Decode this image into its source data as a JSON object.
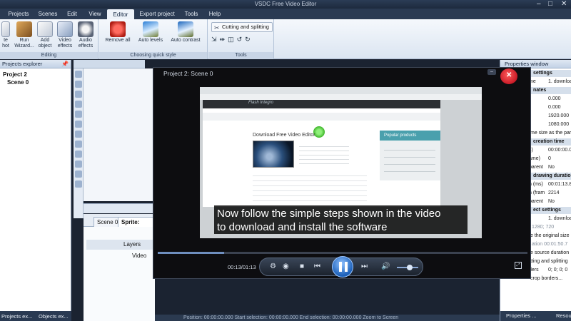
{
  "window": {
    "title": "VSDC Free Video Editor",
    "min": "–",
    "max": "□",
    "close": "✕"
  },
  "menu": [
    "Projects",
    "Scenes",
    "Edit",
    "View",
    "Editor",
    "Export project",
    "Tools",
    "Help"
  ],
  "ribbon": {
    "editing": {
      "label": "Editing",
      "buttons": [
        {
          "label": "Run Wizard...",
          "icon": "wizard-icon"
        },
        {
          "label": "Add object",
          "icon": "add-object-icon"
        },
        {
          "label": "Video effects",
          "icon": "video-effects-icon"
        },
        {
          "label": "Audio effects",
          "icon": "audio-effects-icon"
        }
      ],
      "cut_label": "te hot"
    },
    "quick_style": {
      "label": "Choosing quick style",
      "buttons": [
        {
          "label": "Remove all",
          "icon": "remove-all-icon"
        },
        {
          "label": "Auto levels",
          "icon": "auto-levels-icon"
        },
        {
          "label": "Auto contrast",
          "icon": "auto-contrast-icon"
        }
      ]
    },
    "tools": {
      "label": "Tools",
      "cutting": "Cutting and splitting"
    }
  },
  "project_explorer": {
    "title": "Projects explorer",
    "project": "Project 2",
    "scene": "Scene 0",
    "tabs": [
      "Projects ex...",
      "Objects ex..."
    ]
  },
  "timeline": {
    "tabs": [
      "Scene 0",
      "Sprite: Sprite"
    ],
    "layers_label": "Layers",
    "video_label": "Video"
  },
  "player": {
    "title": "Project 2: Scene 0",
    "time": "00:13/01:13",
    "progress": 0.18,
    "volume": 0.6,
    "caption_line1": "Now follow the simple steps shown in the video",
    "caption_line2": "to download and install the software",
    "video": {
      "site_logo": "Flash Integro",
      "download_title": "Download Free Video Editor",
      "popular": "Popular products"
    }
  },
  "properties": {
    "title": "Properties window",
    "rows": [
      {
        "type": "section",
        "k": "settings"
      },
      {
        "type": "kv",
        "k": "me",
        "v": "1. download"
      },
      {
        "type": "section",
        "k": "nates"
      },
      {
        "type": "kv",
        "k": "",
        "v": "0.000"
      },
      {
        "type": "kv",
        "k": "",
        "v": "0.000"
      },
      {
        "type": "kv",
        "k": "",
        "v": "1920.000"
      },
      {
        "type": "kv",
        "k": "",
        "v": "1080.000"
      },
      {
        "type": "plain",
        "k": "me size as the parent"
      },
      {
        "type": "section",
        "k": "creation time"
      },
      {
        "type": "kv",
        "k": "s)",
        "v": "00:00:00.0"
      },
      {
        "type": "kv",
        "k": "ame)",
        "v": "0"
      },
      {
        "type": "kv",
        "k": "parent",
        "v": "No"
      },
      {
        "type": "section",
        "k": "drawing duration"
      },
      {
        "type": "kv",
        "k": "n (ms)",
        "v": "00:01:13.8"
      },
      {
        "type": "kv",
        "k": "n (fram",
        "v": "2214"
      },
      {
        "type": "kv",
        "k": "parent",
        "v": "No"
      },
      {
        "type": "section",
        "k": "ect settings"
      },
      {
        "type": "kv",
        "k": "",
        "v": "1. download"
      },
      {
        "type": "gray",
        "k": "1280; 720"
      },
      {
        "type": "plain",
        "k": "e the original size"
      },
      {
        "type": "gray",
        "k": "ation 00:01:50.7"
      },
      {
        "type": "plain",
        "k": "e source duration"
      },
      {
        "type": "plain",
        "k": "tting and splitting"
      },
      {
        "type": "kv",
        "k": "ders",
        "v": "0; 0; 0; 0"
      },
      {
        "type": "plain",
        "k": "crop borders..."
      }
    ],
    "tabs": [
      "Properties ...",
      "Resou"
    ]
  },
  "status": {
    "text": "Position: 00:00:00.000   Start selection: 00:00:00.000   End selection: 00:00:00.000   Zoom to Screen"
  },
  "colors": {
    "menu_bg": "#2a3a52",
    "ribbon_bg": "#dbe5f1",
    "accent": "#1b5fb8",
    "close_red": "#c8101e"
  }
}
